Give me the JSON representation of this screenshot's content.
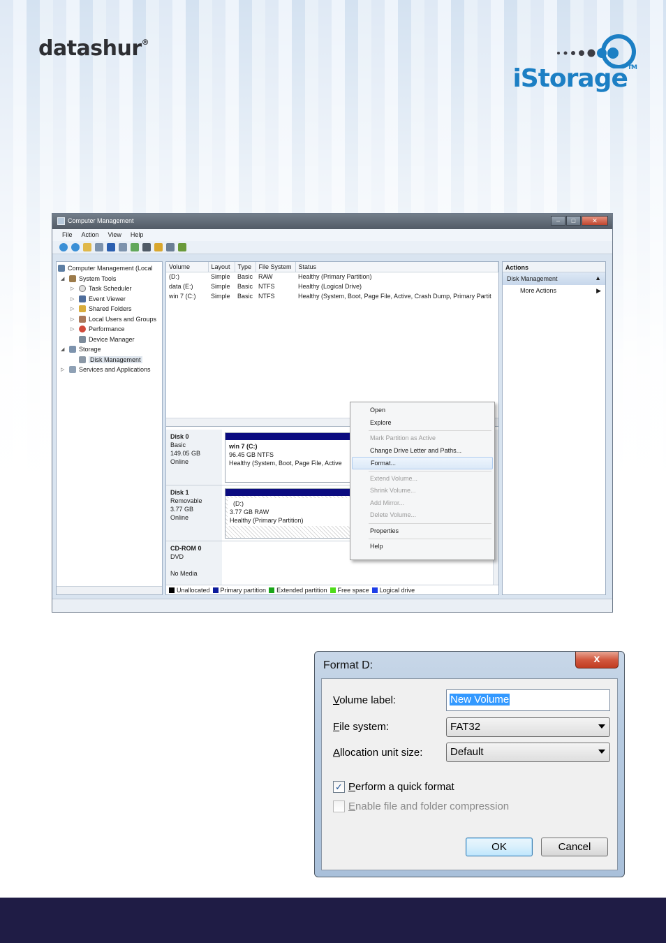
{
  "branding": {
    "left_logo": "datashur",
    "left_logo_mark": "®",
    "right_logo": "iStorage",
    "right_logo_mark": "TM"
  },
  "computer_management": {
    "title": "Computer Management",
    "menu": [
      "File",
      "Action",
      "View",
      "Help"
    ],
    "tree": [
      {
        "label": "Computer Management (Local",
        "level": 0,
        "icon": "computer-icon"
      },
      {
        "label": "System Tools",
        "level": 1,
        "icon": "tools-icon",
        "expanded": true
      },
      {
        "label": "Task Scheduler",
        "level": 2,
        "icon": "clock-icon"
      },
      {
        "label": "Event Viewer",
        "level": 2,
        "icon": "event-viewer-icon"
      },
      {
        "label": "Shared Folders",
        "level": 2,
        "icon": "shared-folder-icon"
      },
      {
        "label": "Local Users and Groups",
        "level": 2,
        "icon": "users-icon"
      },
      {
        "label": "Performance",
        "level": 2,
        "icon": "performance-icon"
      },
      {
        "label": "Device Manager",
        "level": 2,
        "icon": "device-manager-icon"
      },
      {
        "label": "Storage",
        "level": 1,
        "icon": "storage-icon",
        "expanded": true
      },
      {
        "label": "Disk Management",
        "level": 2,
        "icon": "disk-management-icon",
        "selected": true
      },
      {
        "label": "Services and Applications",
        "level": 1,
        "icon": "services-icon"
      }
    ],
    "volume_table": {
      "headers": [
        "Volume",
        "Layout",
        "Type",
        "File System",
        "Status"
      ],
      "rows": [
        [
          "(D:)",
          "Simple",
          "Basic",
          "RAW",
          "Healthy (Primary Partition)"
        ],
        [
          "data (E:)",
          "Simple",
          "Basic",
          "NTFS",
          "Healthy (Logical Drive)"
        ],
        [
          "win 7 (C:)",
          "Simple",
          "Basic",
          "NTFS",
          "Healthy (System, Boot, Page File, Active, Crash Dump, Primary Partit"
        ]
      ]
    },
    "disks": [
      {
        "name": "Disk 0",
        "lines": [
          "Basic",
          "149.05 GB",
          "Online"
        ],
        "partition_title": "win 7  (C:)",
        "partition_lines": [
          "96.45 GB NTFS",
          "Healthy (System, Boot, Page File, Active"
        ]
      },
      {
        "name": "Disk 1",
        "lines": [
          "Removable",
          "3.77 GB",
          "Online"
        ],
        "partition_title": "(D:)",
        "partition_lines": [
          "3.77 GB RAW",
          "Healthy (Primary Partition)"
        ]
      },
      {
        "name": "CD-ROM 0",
        "lines": [
          "DVD",
          "",
          "No Media"
        ]
      }
    ],
    "legend": [
      {
        "label": "Unallocated",
        "color": "#000000"
      },
      {
        "label": "Primary partition",
        "color": "#0c1b9c"
      },
      {
        "label": "Extended partition",
        "color": "#1aa61a"
      },
      {
        "label": "Free space",
        "color": "#4fdc1a"
      },
      {
        "label": "Logical drive",
        "color": "#1e3ee8"
      }
    ],
    "actions": {
      "header": "Actions",
      "section": "Disk Management",
      "more": "More Actions"
    },
    "context_menu": [
      {
        "label": "Open",
        "enabled": true
      },
      {
        "label": "Explore",
        "enabled": true
      },
      {
        "sep": true
      },
      {
        "label": "Mark Partition as Active",
        "enabled": false
      },
      {
        "label": "Change Drive Letter and Paths...",
        "enabled": true
      },
      {
        "label": "Format...",
        "enabled": true,
        "highlighted": true
      },
      {
        "sep": true
      },
      {
        "label": "Extend Volume...",
        "enabled": false
      },
      {
        "label": "Shrink Volume...",
        "enabled": false
      },
      {
        "label": "Add Mirror...",
        "enabled": false
      },
      {
        "label": "Delete Volume...",
        "enabled": false
      },
      {
        "sep": true
      },
      {
        "label": "Properties",
        "enabled": true
      },
      {
        "sep": true
      },
      {
        "label": "Help",
        "enabled": true
      }
    ]
  },
  "format_dialog": {
    "title": "Format D:",
    "close_glyph": "x",
    "volume_label": {
      "label_pre": "",
      "label_key": "V",
      "label_post": "olume label:",
      "value": "New Volume"
    },
    "file_system": {
      "label_pre": "",
      "label_key": "F",
      "label_post": "ile system:",
      "value": "FAT32"
    },
    "allocation": {
      "label_pre": "",
      "label_key": "A",
      "label_post": "llocation unit size:",
      "value": "Default"
    },
    "quick_format": {
      "label_pre": "",
      "label_key": "P",
      "label_post": "erform a quick format",
      "checked": true
    },
    "compression": {
      "label_pre": "",
      "label_key": "E",
      "label_post": "nable file and folder compression",
      "checked": false,
      "enabled": false
    },
    "ok_label": "OK",
    "cancel_label": "Cancel"
  }
}
